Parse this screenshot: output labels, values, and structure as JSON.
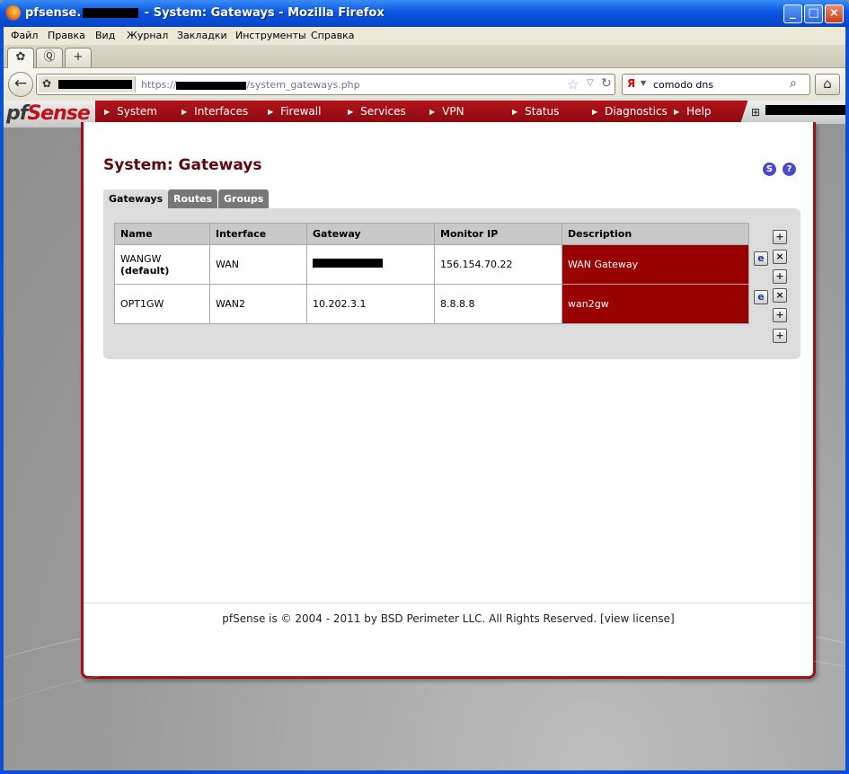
{
  "window": {
    "title_prefix": "pfsense.",
    "title_suffix": " - System: Gateways - Mozilla Firefox",
    "minimize": "_",
    "maximize": "□",
    "close": "×"
  },
  "menubar": {
    "items": [
      "Файл",
      "Правка",
      "Вид",
      "Журнал",
      "Закладки",
      "Инструменты",
      "Справка"
    ]
  },
  "tabs": {
    "new_tab": "+"
  },
  "navbar": {
    "url_scheme": "https://",
    "url_path": "/system_gateways.php",
    "search_value": "comodo dns",
    "search_engine": "Я"
  },
  "pfsense": {
    "logo_prefix": "pf",
    "logo_suffix": "Sense",
    "nav": [
      "System",
      "Interfaces",
      "Firewall",
      "Services",
      "VPN",
      "Status",
      "Diagnostics",
      "Help"
    ]
  },
  "main": {
    "page_title": "System: Gateways",
    "help_s": "S",
    "help_q": "?",
    "subtabs": [
      "Gateways",
      "Routes",
      "Groups"
    ],
    "columns": [
      "Name",
      "Interface",
      "Gateway",
      "Monitor IP",
      "Description"
    ],
    "rows": [
      {
        "name": "WANGW",
        "name_note": "(default)",
        "interface": "WAN",
        "gateway": "",
        "monitor_ip": "156.154.70.22",
        "description": "WAN Gateway"
      },
      {
        "name": "OPT1GW",
        "name_note": "",
        "interface": "WAN2",
        "gateway": "10.202.3.1",
        "monitor_ip": "8.8.8.8",
        "description": "wan2gw"
      }
    ]
  },
  "footer": {
    "text": "pfSense is © 2004 - 2011 by BSD Perimeter LLC. All Rights Reserved. [view license]"
  },
  "colors": {
    "pfsense_red": "#990000",
    "xp_blue": "#0a55e0"
  }
}
